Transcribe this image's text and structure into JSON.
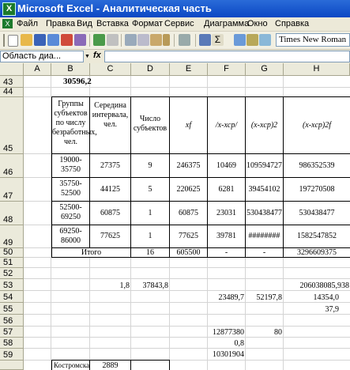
{
  "window": {
    "title": "Microsoft Excel - Аналитическая часть"
  },
  "menu": [
    "Файл",
    "Правка",
    "Вид",
    "Вставка",
    "Формат",
    "Сервис",
    "Диаграмма",
    "Окно",
    "Справка"
  ],
  "toolbar": {
    "font_name": "Times New Roman"
  },
  "formula_bar": {
    "name_box": "Область диа...",
    "fx_label": "fx",
    "formula": ""
  },
  "columns": [
    "A",
    "B",
    "C",
    "D",
    "E",
    "F",
    "G",
    "H"
  ],
  "rows": [
    "43",
    "44",
    "45",
    "46",
    "47",
    "48",
    "49",
    "50",
    "51",
    "52",
    "53",
    "54",
    "55",
    "56",
    "57",
    "58",
    "59"
  ],
  "cells": {
    "b43": "30596,2",
    "hdr_b": "Группы субъектов по числу безработных, чел.",
    "hdr_c": "Середина интервала, чел.",
    "hdr_d": "Число субъектов",
    "hdr_e": "xf",
    "hdr_f": "/x-xср/",
    "hdr_g": "(x-xср)2",
    "hdr_h": "(x-xср)2f",
    "r46": [
      "19000-35750",
      "27375",
      "9",
      "246375",
      "10469",
      "109594727",
      "986352539"
    ],
    "r47": [
      "35750-52500",
      "44125",
      "5",
      "220625",
      "6281",
      "39454102",
      "197270508"
    ],
    "r48": [
      "52500-69250",
      "60875",
      "1",
      "60875",
      "23031",
      "530438477",
      "530438477"
    ],
    "r49": [
      "69250-86000",
      "77625",
      "1",
      "77625",
      "39781",
      "########",
      "1582547852"
    ],
    "r50": [
      "Итого",
      "16",
      "605500",
      "-",
      "-",
      "3296609375"
    ],
    "c53": "1,8",
    "d53": "37843,8",
    "h53": "206038085,938",
    "f54": "23489,7",
    "g54": "52197,8",
    "h54": "14354,0",
    "h55": "37,9",
    "f57": "12877380",
    "g57": "80",
    "f58": "0,8",
    "f59": "10301904",
    "b60": "Костромска",
    "c60": "2889"
  }
}
